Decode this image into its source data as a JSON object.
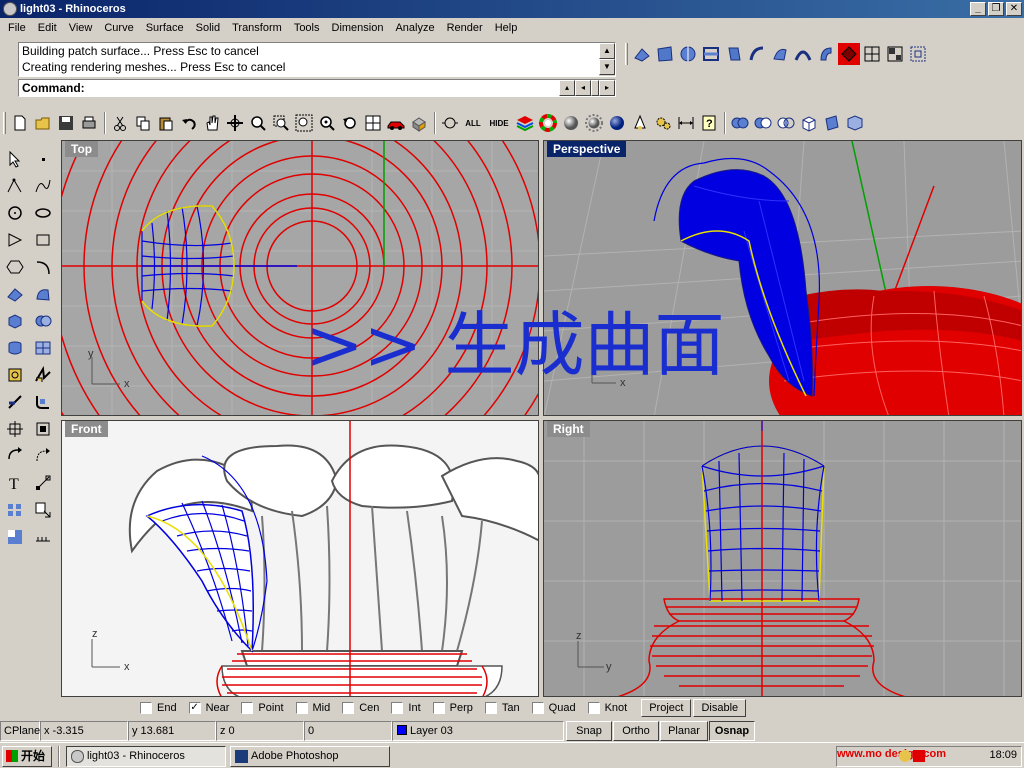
{
  "window": {
    "title": "light03 - Rhinoceros"
  },
  "menu": [
    "File",
    "Edit",
    "View",
    "Curve",
    "Surface",
    "Solid",
    "Transform",
    "Tools",
    "Dimension",
    "Analyze",
    "Render",
    "Help"
  ],
  "command": {
    "history": [
      "Building patch surface... Press Esc to cancel",
      "Creating rendering meshes... Press Esc to cancel"
    ],
    "prompt": "Command:"
  },
  "toolbar": {
    "all_label": "ALL",
    "hide_label": "HIDE"
  },
  "viewports": {
    "top": "Top",
    "perspective": "Perspective",
    "front": "Front",
    "right": "Right"
  },
  "axis_labels": {
    "x": "x",
    "y": "y",
    "z": "z"
  },
  "overlay_text": ">> 生成曲面",
  "osnap": {
    "items": [
      {
        "label": "End",
        "checked": false
      },
      {
        "label": "Near",
        "checked": true
      },
      {
        "label": "Point",
        "checked": false
      },
      {
        "label": "Mid",
        "checked": false
      },
      {
        "label": "Cen",
        "checked": false
      },
      {
        "label": "Int",
        "checked": false
      },
      {
        "label": "Perp",
        "checked": false
      },
      {
        "label": "Tan",
        "checked": false
      },
      {
        "label": "Quad",
        "checked": false
      },
      {
        "label": "Knot",
        "checked": false
      }
    ],
    "project": "Project",
    "disable": "Disable"
  },
  "status": {
    "cplane": "CPlane",
    "x": "x -3.315",
    "y": "y 13.681",
    "z": "z 0",
    "extra": "0",
    "layer": "Layer 03",
    "layer_color": "#0000ff",
    "snap": "Snap",
    "ortho": "Ortho",
    "planar": "Planar",
    "osnap": "Osnap"
  },
  "taskbar": {
    "start": "开始",
    "tasks": [
      "light03 - Rhinoceros",
      "Adobe Photoshop"
    ],
    "tray_text": "www.mo  design.com",
    "clock": "18:09"
  },
  "colors": {
    "title_bar": "#0a246a",
    "curve_red": "#e00000",
    "surface_blue": "#0000e0",
    "viewport_grey": "#9a9a9a",
    "overlay_text": "#1a2ed0"
  }
}
